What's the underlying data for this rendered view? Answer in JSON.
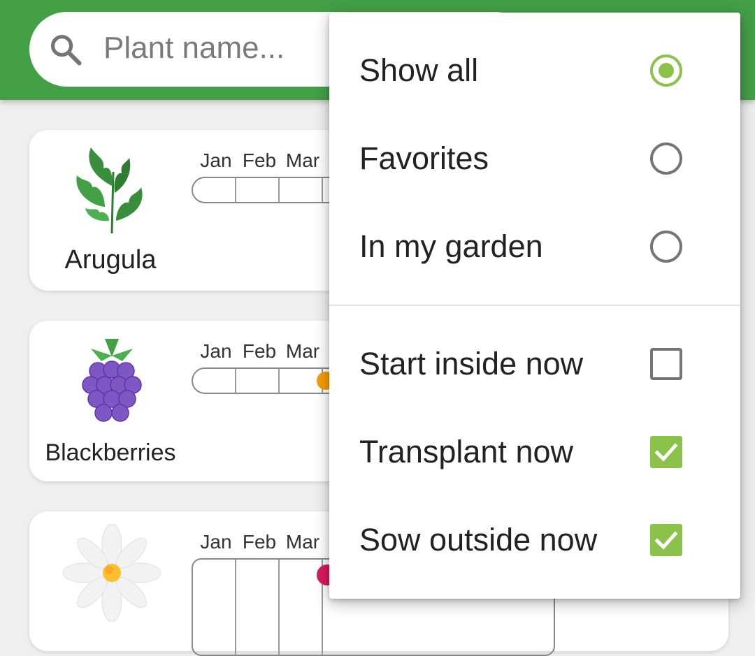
{
  "search": {
    "placeholder": "Plant name..."
  },
  "months": [
    "Jan",
    "Feb",
    "Mar"
  ],
  "plants": [
    {
      "name": "Arugula"
    },
    {
      "name": "Blackberries"
    },
    {
      "name": ""
    }
  ],
  "filter_menu": {
    "view_options": [
      {
        "label": "Show all",
        "selected": true
      },
      {
        "label": "Favorites",
        "selected": false
      },
      {
        "label": "In my garden",
        "selected": false
      }
    ],
    "action_filters": [
      {
        "label": "Start inside now",
        "checked": false
      },
      {
        "label": "Transplant now",
        "checked": true
      },
      {
        "label": "Sow outside now",
        "checked": true
      }
    ]
  },
  "colors": {
    "app_bar": "#43a047",
    "accent": "#8bc34a",
    "control_off": "#757575",
    "sow_marker": "#f59c00",
    "flower_marker": "#d81b60"
  }
}
